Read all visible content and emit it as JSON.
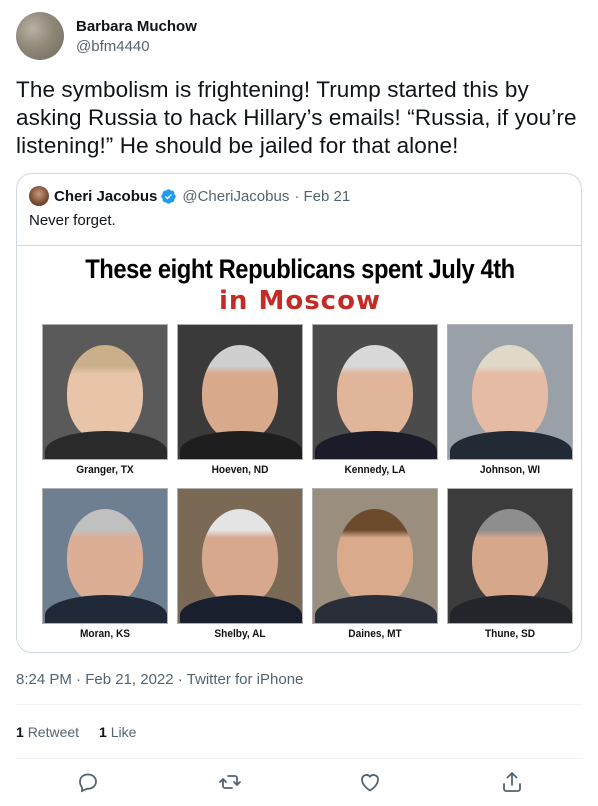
{
  "author": {
    "name": "Barbara Muchow",
    "handle": "@bfm4440"
  },
  "tweet": {
    "text": "The symbolism is frightening! Trump started this by asking Russia to hack Hillary’s emails! “Russia, if you’re listening!” He should be jailed for that alone!"
  },
  "quoted": {
    "name": "Cheri Jacobus",
    "handle": "@CheriJacobus",
    "date": "· Feb 21",
    "text": "Never forget.",
    "image": {
      "title_line1": "These eight Republicans spent July 4th",
      "title_line2": "in Moscow",
      "people": [
        {
          "caption": "Granger, TX",
          "skin": "#e8c4a8",
          "bg": "#5a5a5a",
          "hair": "#c9b08a",
          "suit": "#2a2a2a"
        },
        {
          "caption": "Hoeven, ND",
          "skin": "#d9a98c",
          "bg": "#3a3a3a",
          "hair": "#cfcfcf",
          "suit": "#1e1e1e"
        },
        {
          "caption": "Kennedy, LA",
          "skin": "#e0b59a",
          "bg": "#4b4b4b",
          "hair": "#d8d8d8",
          "suit": "#1b1b2a"
        },
        {
          "caption": "Johnson, WI",
          "skin": "#e6bba5",
          "bg": "#9aa0a8",
          "hair": "#e0d8c8",
          "suit": "#222a35"
        },
        {
          "caption": "Moran, KS",
          "skin": "#dcae95",
          "bg": "#6e7f92",
          "hair": "#c0c0c0",
          "suit": "#1f2937"
        },
        {
          "caption": "Shelby, AL",
          "skin": "#d8a88e",
          "bg": "#7a6a55",
          "hair": "#e4e4e4",
          "suit": "#1a1f2e"
        },
        {
          "caption": "Daines, MT",
          "skin": "#d9ab8c",
          "bg": "#9a8f7e",
          "hair": "#6b4a2e",
          "suit": "#2a2e38"
        },
        {
          "caption": "Thune, SD",
          "skin": "#d6a78a",
          "bg": "#3c3c3c",
          "hair": "#8e8e8e",
          "suit": "#23252b"
        }
      ]
    }
  },
  "meta": {
    "time": "8:24 PM · Feb 21, 2022 · Twitter for iPhone"
  },
  "stats": {
    "retweets": "1",
    "retweets_label": "Retweet",
    "likes": "1",
    "likes_label": "Like"
  },
  "colors": {
    "verified": "#1d9bf0",
    "action_icon": "#536471",
    "title_red": "#c52b25"
  },
  "actions": [
    "reply-icon",
    "retweet-icon",
    "like-icon",
    "share-icon"
  ]
}
